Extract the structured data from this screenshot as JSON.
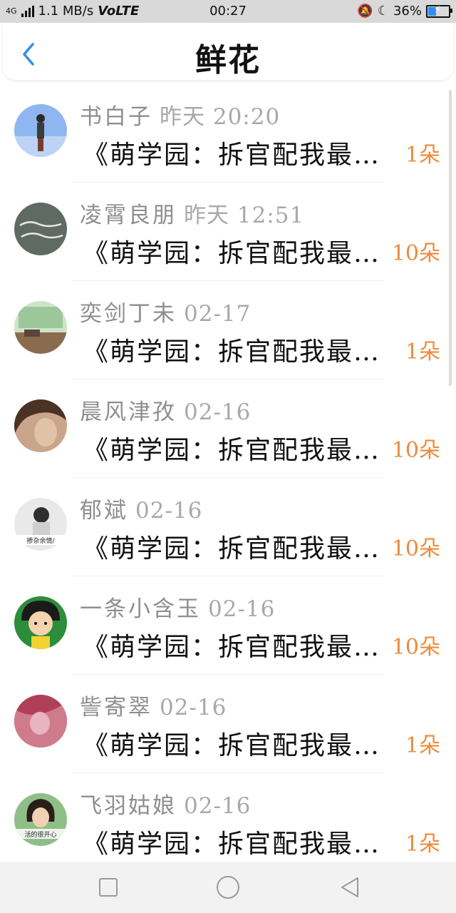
{
  "status_bar": {
    "network": "4G",
    "speed": "1.1 MB/s",
    "volte": "VoLTE",
    "time": "00:27",
    "battery": "36%"
  },
  "header": {
    "title": "鲜花"
  },
  "list": [
    {
      "name": "书白子",
      "time": "昨天 20:20",
      "book": "《萌学园：拆官配我最…",
      "count": "1朵",
      "avatar_color": "#7aa6e8"
    },
    {
      "name": "凌霄良朋",
      "time": "昨天 12:51",
      "book": "《萌学园：拆官配我最…",
      "count": "10朵",
      "avatar_color": "#6c7a70"
    },
    {
      "name": "奕剑丁未",
      "time": "02-17",
      "book": "《萌学园：拆官配我最…",
      "count": "1朵",
      "avatar_color": "#8db58d"
    },
    {
      "name": "晨风津孜",
      "time": "02-16",
      "book": "《萌学园：拆官配我最…",
      "count": "10朵",
      "avatar_color": "#7a5a44"
    },
    {
      "name": "郁斌",
      "time": "02-16",
      "book": "《萌学园：拆官配我最…",
      "count": "10朵",
      "avatar_color": "#c9c9c9"
    },
    {
      "name": "一条小含玉",
      "time": "02-16",
      "book": "《萌学园：拆官配我最…",
      "count": "10朵",
      "avatar_color": "#2d8d3a"
    },
    {
      "name": "訾寄翠",
      "time": "02-16",
      "book": "《萌学园：拆官配我最…",
      "count": "1朵",
      "avatar_color": "#b0405a"
    },
    {
      "name": "飞羽姑娘",
      "time": "02-16",
      "book": "《萌学园：拆官配我最…",
      "count": "1朵",
      "avatar_color": "#7aa870"
    }
  ],
  "avatar_captions": [
    "",
    "",
    "",
    "",
    "掺杂余情/",
    "",
    "",
    "活的很开心"
  ],
  "icons": {
    "back": "chevron-left-icon",
    "nav": [
      "square-icon",
      "circle-icon",
      "triangle-back-icon"
    ]
  },
  "colors": {
    "accent": "#2f8df0",
    "count": "#f08a3a"
  }
}
